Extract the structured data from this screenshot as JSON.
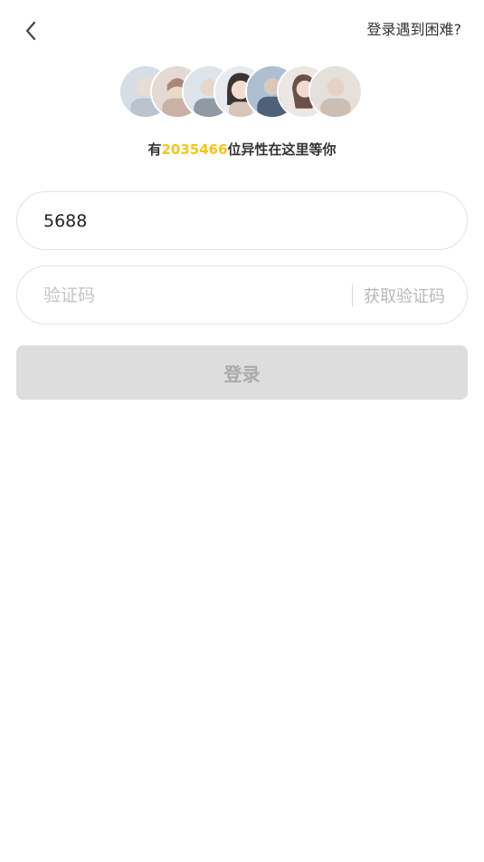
{
  "header": {
    "back_icon": "chevron-left-icon",
    "help_link": "登录遇到困难?"
  },
  "promo": {
    "prefix": "有",
    "count": "2035466",
    "suffix": "位异性在这里等你",
    "count_color": "#f5c518"
  },
  "form": {
    "phone_value": "5688",
    "code_placeholder": "验证码",
    "get_code_label": "获取验证码",
    "login_label": "登录"
  }
}
